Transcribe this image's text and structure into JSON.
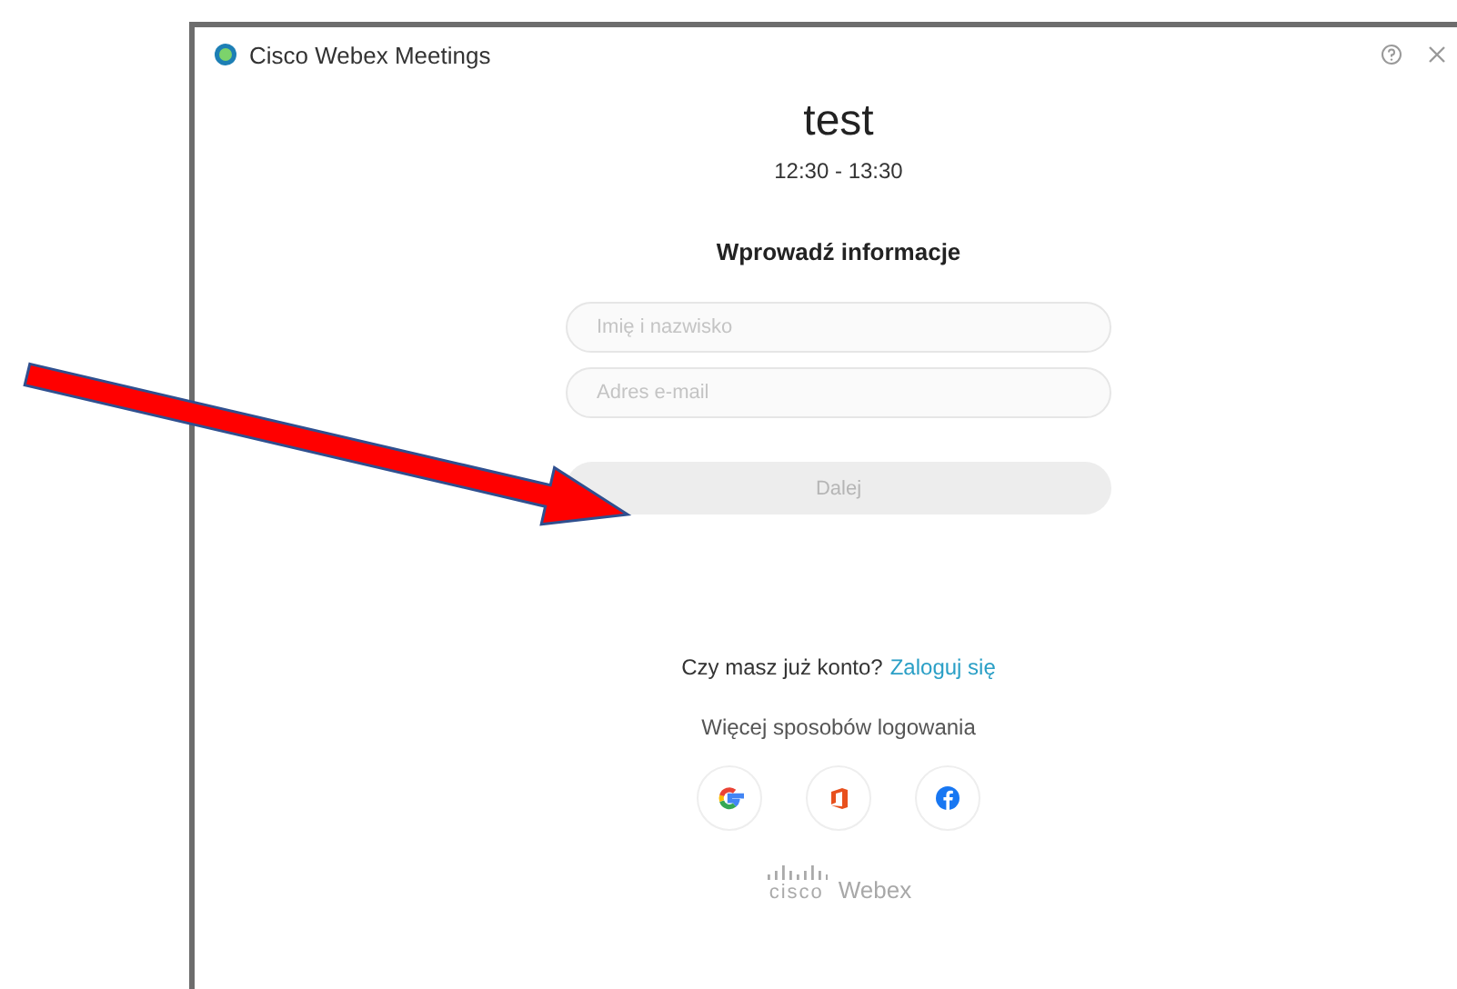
{
  "window": {
    "title": "Cisco Webex Meetings"
  },
  "meeting": {
    "title": "test",
    "time": "12:30 - 13:30"
  },
  "form": {
    "heading": "Wprowadź informacje",
    "fields": [
      {
        "placeholder": "Imię i nazwisko"
      },
      {
        "placeholder": "Adres e-mail"
      }
    ],
    "submit": {
      "label": "Dalej",
      "disabled": true
    }
  },
  "account": {
    "prompt": "Czy masz już konto?",
    "link": "Zaloguj się"
  },
  "more_ways": {
    "label": "Więcej sposobów logowania",
    "providers": [
      {
        "kind": "google"
      },
      {
        "kind": "office"
      },
      {
        "kind": "facebook"
      }
    ]
  },
  "brand": {
    "company": "cisco",
    "product": "Webex"
  }
}
